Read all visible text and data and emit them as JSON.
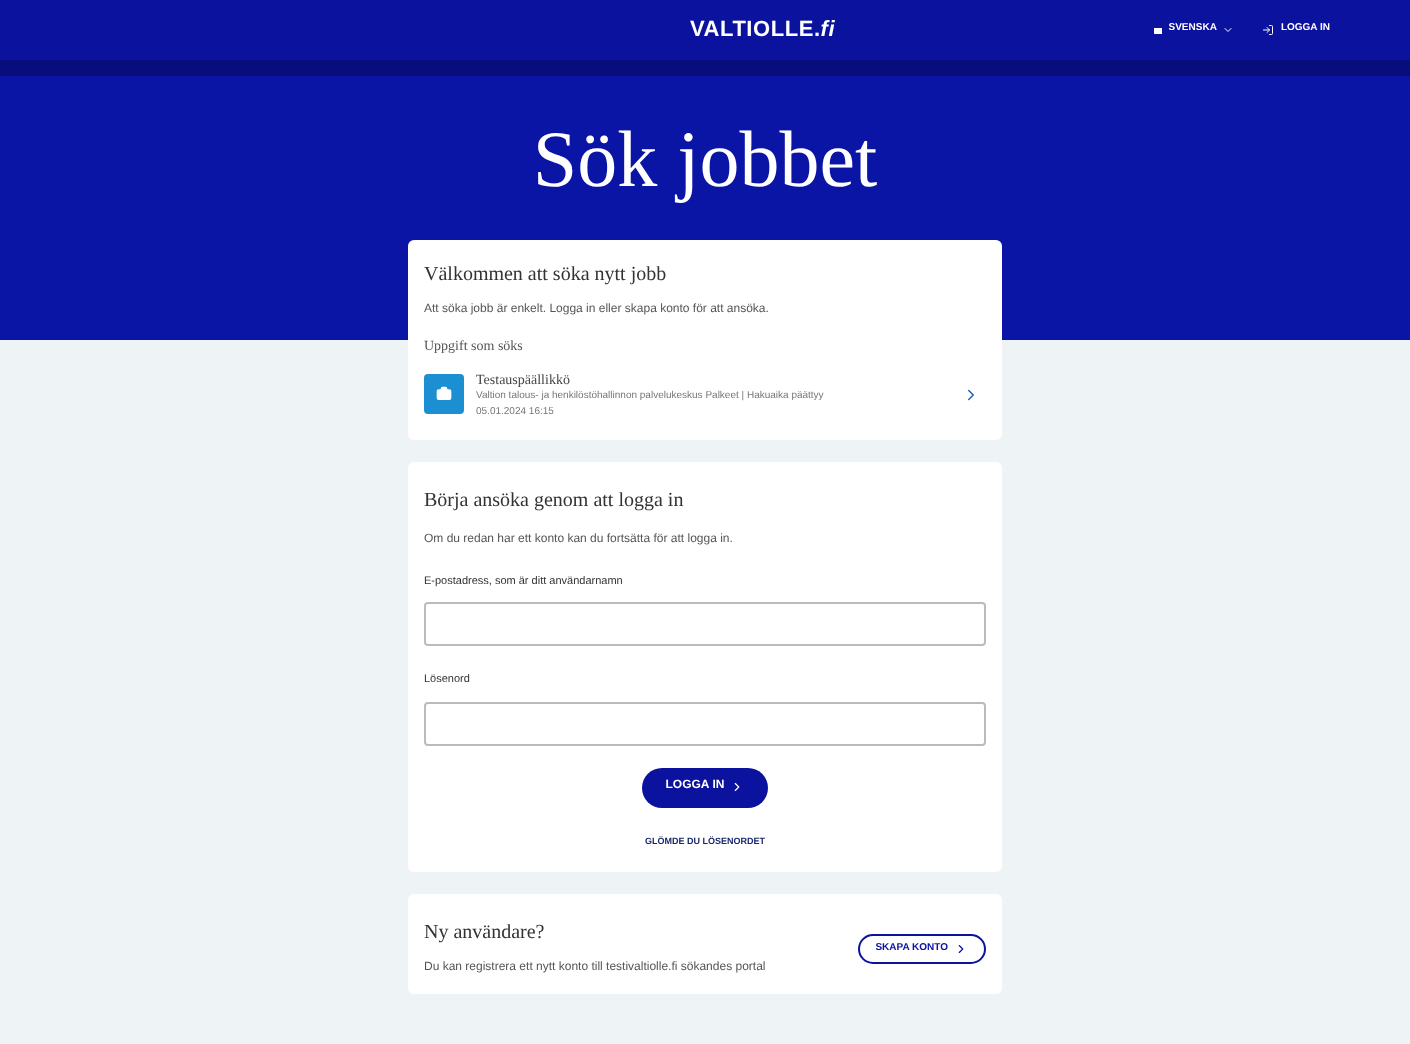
{
  "header": {
    "logo": "VALTIOLLE.*fi*",
    "language": "SVENSKA",
    "login": "LOGGA IN"
  },
  "hero": {
    "title": "Sök jobbet"
  },
  "welcome": {
    "title": "Välkommen att söka nytt jobb",
    "text": "Att söka jobb är enkelt. Logga in eller skapa konto för att ansöka.",
    "subtitle": "Uppgift som söks",
    "job": {
      "title": "Testauspäällikkö",
      "organization": "Valtion talous- ja henkilöstöhallinnon palvelukeskus Palkeet | Hakuaika päättyy",
      "deadline": "05.01.2024 16:15"
    }
  },
  "login": {
    "title": "Börja ansöka genom att logga in",
    "text": "Om du redan har ett konto kan du fortsätta för att logga in.",
    "email_label": "E-postadress, som är ditt användarnamn",
    "password_label": "Lösenord",
    "button": "LOGGA IN",
    "forgot": "GLÖMDE DU LÖSENORDET"
  },
  "new_user": {
    "title": "Ny användare?",
    "text": "Du kan registrera ett nytt konto till testivaltiolle.fi sökandes portal",
    "button": "SKAPA KONTO"
  }
}
